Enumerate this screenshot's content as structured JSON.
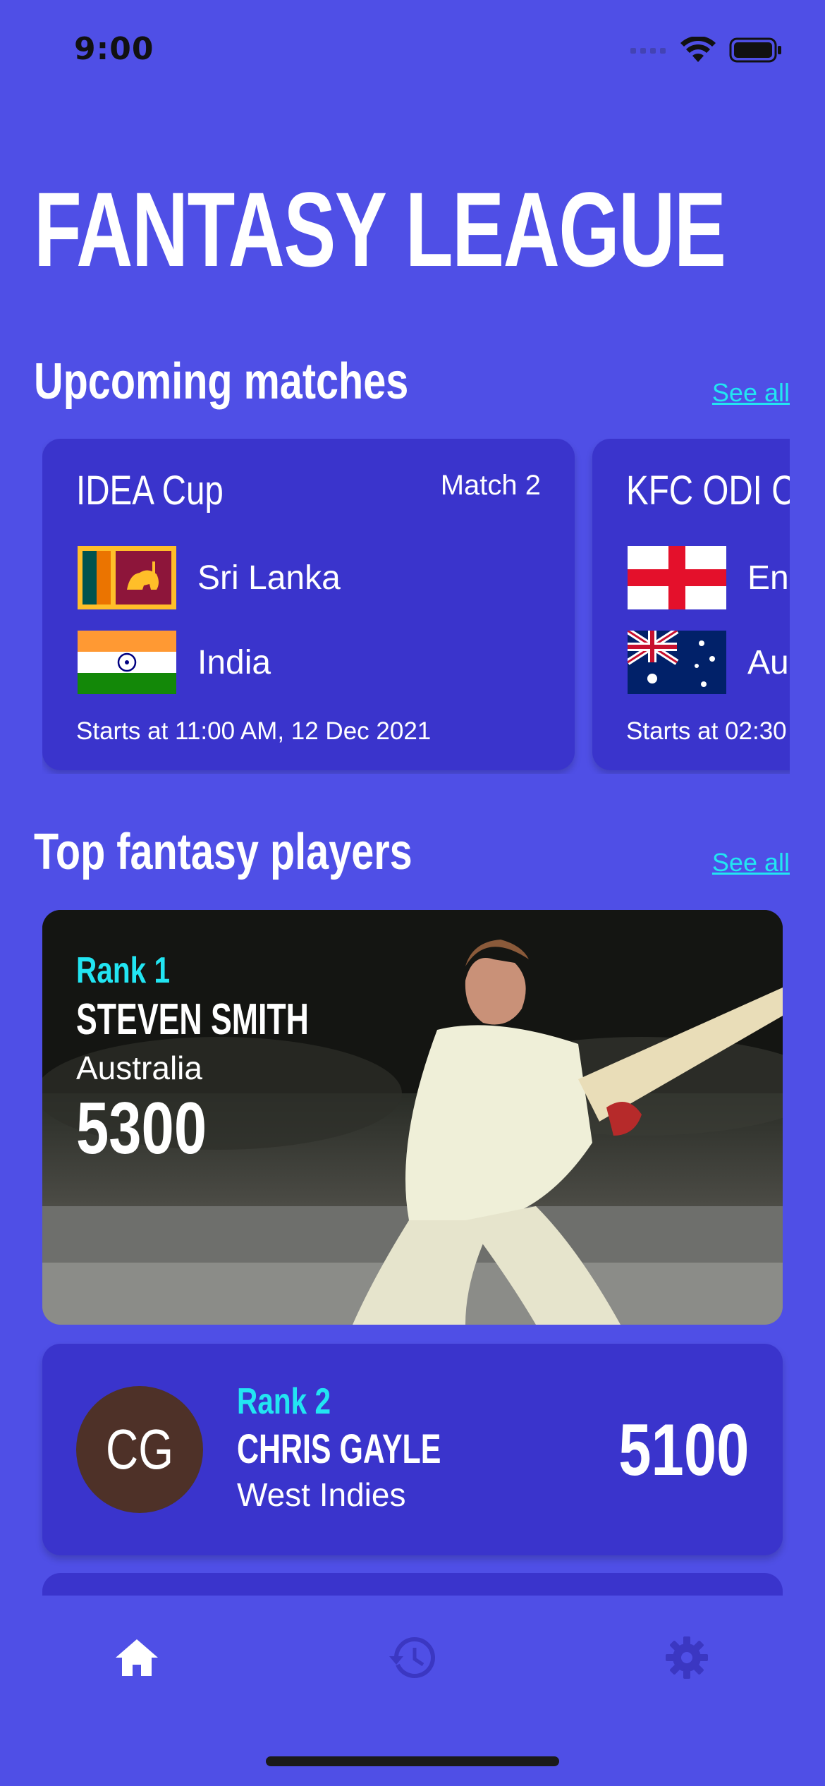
{
  "status_bar": {
    "time": "9:00"
  },
  "header": {
    "title": "FANTASY LEAGUE"
  },
  "upcoming": {
    "title": "Upcoming matches",
    "see_all": "See all",
    "matches": [
      {
        "cup": "IDEA Cup",
        "match_no": "Match 2",
        "team1": "Sri Lanka",
        "team2": "India",
        "starts": "Starts at 11:00 AM, 12 Dec 2021"
      },
      {
        "cup": "KFC ODI Cup",
        "team1": "England",
        "team2": "Australia",
        "starts": "Starts at 02:30"
      }
    ]
  },
  "top_players": {
    "title": "Top fantasy players",
    "see_all": "See all",
    "players": [
      {
        "rank": "Rank 1",
        "name": "STEVEN SMITH",
        "country": "Australia",
        "points": "5300"
      },
      {
        "rank": "Rank 2",
        "initials": "CG",
        "name": "CHRIS GAYLE",
        "country": "West Indies",
        "points": "5100"
      }
    ]
  },
  "tab_bar": {
    "icons": [
      "home-icon",
      "history-icon",
      "settings-icon"
    ]
  },
  "colors": {
    "background": "#4F4FE6",
    "card": "#3A34CC",
    "accent": "#22E5F2"
  }
}
